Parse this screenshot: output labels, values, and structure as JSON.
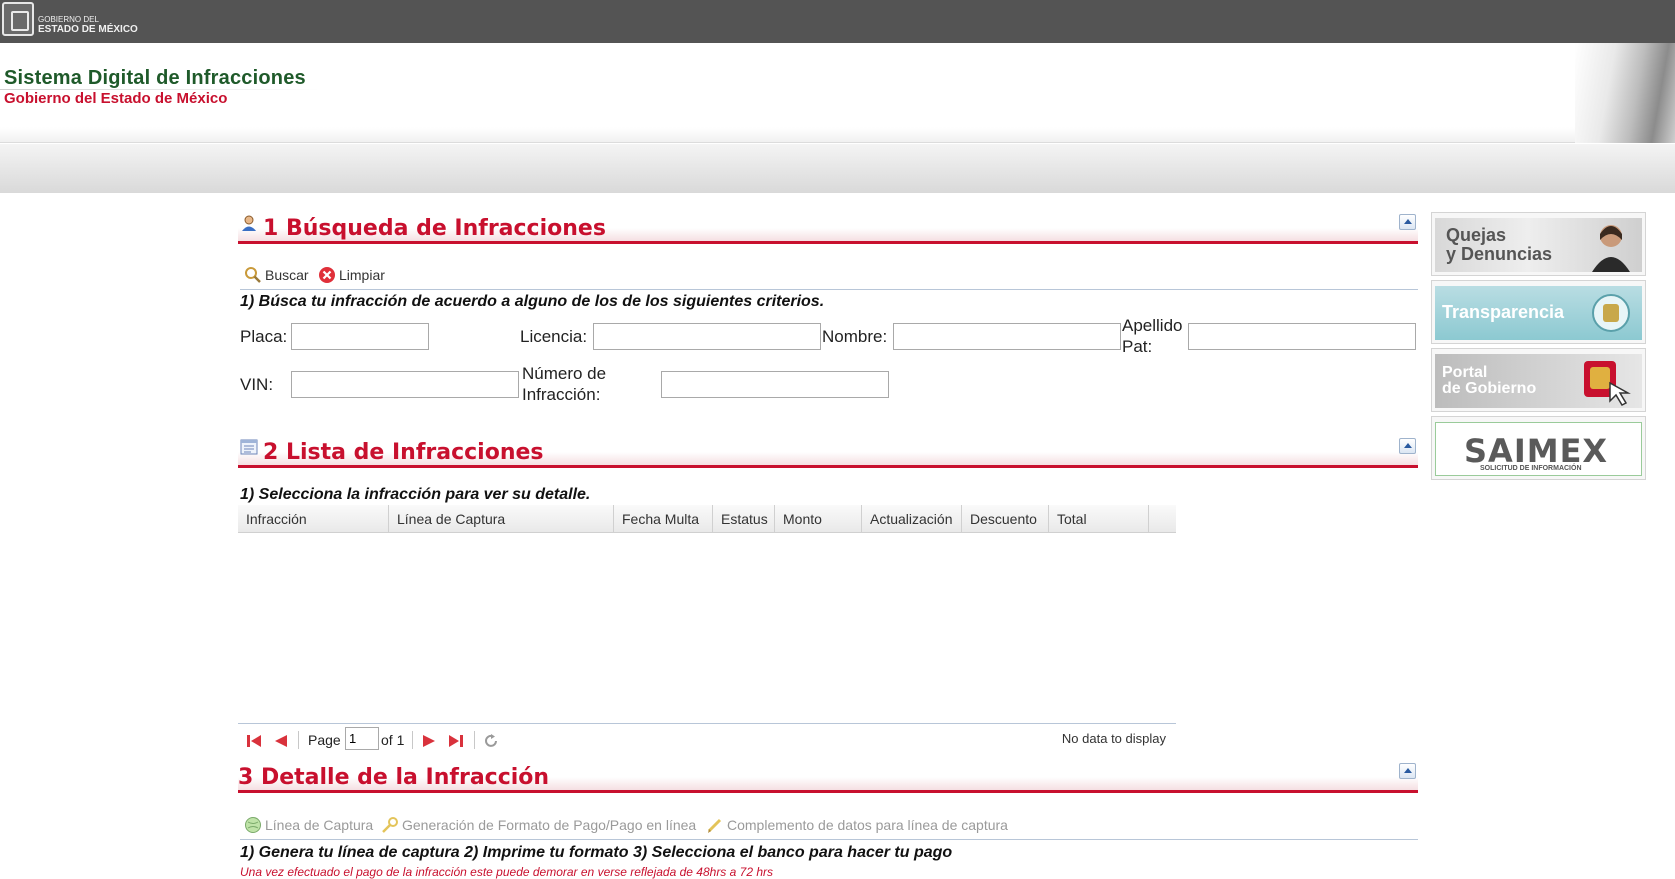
{
  "topbar": {
    "gov_line1": "GOBIERNO DEL",
    "gov_line2": "ESTADO DE MÉXICO"
  },
  "header": {
    "title": "Sistema Digital de Infracciones",
    "subtitle": "Gobierno del Estado de México"
  },
  "section1": {
    "title": "1 Búsqueda de Infracciones",
    "toolbar": {
      "search_label": "Buscar",
      "clear_label": "Limpiar"
    },
    "hint": "1) Búsca tu infracción de acuerdo a alguno de los de los siguientes criterios.",
    "fields": {
      "placa": {
        "label": "Placa:",
        "value": ""
      },
      "licencia": {
        "label": "Licencia:",
        "value": ""
      },
      "nombre": {
        "label": "Nombre:",
        "value": ""
      },
      "apellido_line1": "Apellido",
      "apellido_line2": "Pat:",
      "apellido_value": "",
      "vin": {
        "label": "VIN:",
        "value": ""
      },
      "numero_line1": "Número de",
      "numero_line2": "Infracción:",
      "numero_value": ""
    }
  },
  "section2": {
    "title": "2 Lista de Infracciones",
    "hint": "1) Selecciona la infracción para ver su detalle.",
    "columns": [
      "Infracción",
      "Línea de Captura",
      "Fecha Multa",
      "Estatus",
      "Monto",
      "Actualización",
      "Descuento",
      "Total"
    ],
    "rows": [],
    "pager": {
      "page_label": "Page",
      "page_value": "1",
      "of_label": "of 1",
      "empty_message": "No data to display"
    }
  },
  "section3": {
    "title": "3 Detalle de la Infracción",
    "toolbar": {
      "linea_label": "Línea de Captura",
      "formato_label": "Generación de Formato de Pago/Pago en línea",
      "complemento_label": "Complemento de datos para línea de captura"
    },
    "hint": "1) Genera tu línea de captura 2) Imprime tu formato 3) Selecciona el banco para hacer tu pago",
    "note": "Una vez efectuado el pago de la infracción este puede demorar en verse reflejada de 48hrs a 72 hrs"
  },
  "side": {
    "quejas_line1": "Quejas",
    "quejas_line2": "y Denuncias",
    "transparencia": "Transparencia",
    "portal_line1": "Portal",
    "portal_line2": "de Gobierno",
    "saimex": "SAIMEX",
    "saimex_sub": "SOLICITUD DE INFORMACIÓN"
  },
  "colors": {
    "accent_red": "#c8102e",
    "title_green": "#1f5a2a",
    "topbar": "#545454"
  },
  "icons": [
    "user-icon",
    "list-icon",
    "collapse-icon",
    "search-icon",
    "clear-icon",
    "first-page-icon",
    "prev-page-icon",
    "next-page-icon",
    "last-page-icon",
    "refresh-icon",
    "globe-icon",
    "key-icon",
    "pencil-icon"
  ]
}
